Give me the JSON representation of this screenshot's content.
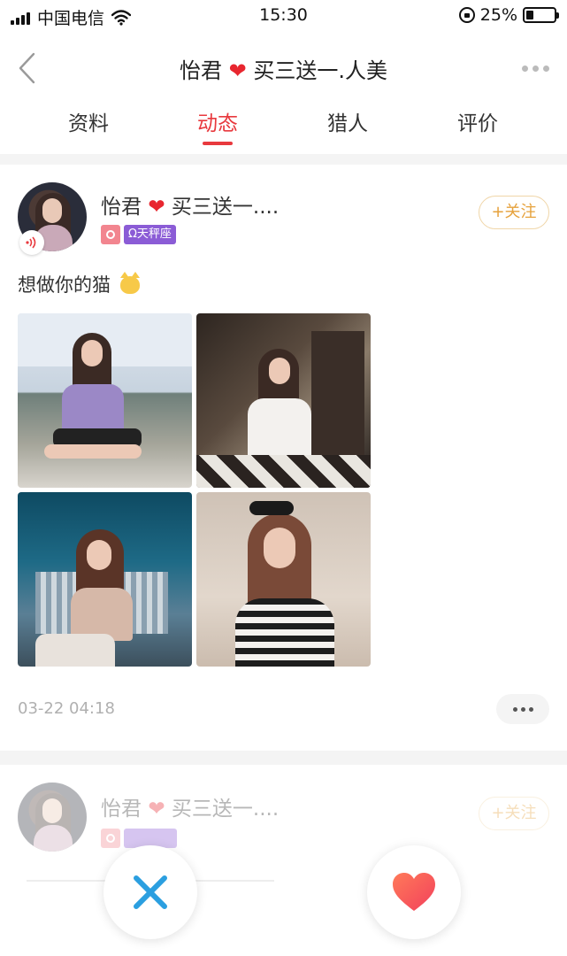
{
  "status_bar": {
    "carrier": "中国电信",
    "time": "15:30",
    "battery": "25%",
    "battery_level": 0.25
  },
  "nav": {
    "title_name": "怡君",
    "title_suffix": "买三送一.人美"
  },
  "tabs": [
    {
      "label": "资料",
      "active": false
    },
    {
      "label": "动态",
      "active": true
    },
    {
      "label": "猎人",
      "active": false
    },
    {
      "label": "评价",
      "active": false
    }
  ],
  "post": {
    "user_name": "怡君",
    "user_suffix": "买三送一....",
    "zodiac": "Ω天秤座",
    "follow_label": "+关注",
    "text": "想做你的猫",
    "time": "03-22 04:18"
  },
  "post2": {
    "user_name": "怡君",
    "user_suffix": "买三送一....",
    "follow_label": "+关注"
  },
  "colors": {
    "accent": "#e8393e",
    "follow": "#e6a23c",
    "zodiac": "#8b5cd6",
    "gender": "#f2858f"
  },
  "icons": {
    "back": "chevron-left-icon",
    "more": "more-dots-icon",
    "voice": "voice-wave-icon",
    "gender": "female-icon",
    "dislike": "x-icon",
    "like": "heart-icon"
  }
}
